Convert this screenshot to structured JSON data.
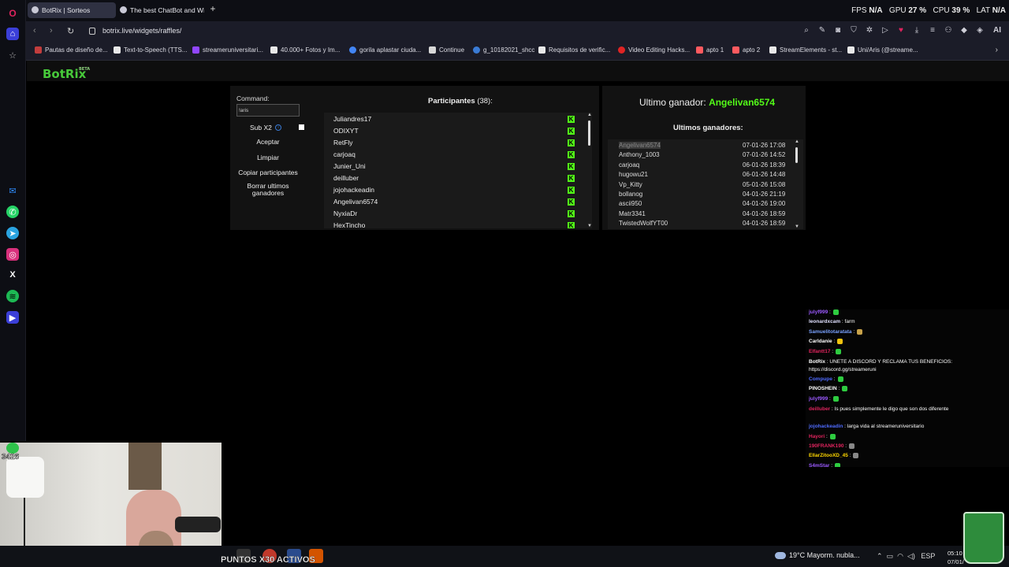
{
  "browser": {
    "tabs": [
      {
        "title": "BotRix | Sorteos"
      },
      {
        "title": "The best ChatBot and Wid"
      }
    ],
    "new_tab": "+",
    "stats": {
      "fps_label": "FPS",
      "fps_value": "N/A",
      "gpu_label": "GPU",
      "gpu_value": "27 %",
      "cpu_label": "CPU",
      "cpu_value": "39 %",
      "lat_label": "LAT",
      "lat_value": "N/A"
    },
    "url": "botrix.live/widgets/raffles/",
    "ai_label": "AI",
    "bookmarks": [
      {
        "label": "Pautas de diseño de...",
        "color": "#c23d3d"
      },
      {
        "label": "Text-to-Speech (TTS...",
        "color": "#e8e8e8"
      },
      {
        "label": "streameruniversitari...",
        "color": "#9146ff"
      },
      {
        "label": "40.000+ Fotos y Im...",
        "color": "#e8e8e8"
      },
      {
        "label": "gorila aplastar ciuda...",
        "color": "#4285f4"
      },
      {
        "label": "Continue",
        "color": "#d8d8d8"
      },
      {
        "label": "g_10182021_shcc",
        "color": "#3a7bd5"
      },
      {
        "label": "Requisitos de verific...",
        "color": "#e8e8e8"
      },
      {
        "label": "Video Editing Hacks...",
        "color": "#e02424"
      },
      {
        "label": "apto 1",
        "color": "#ff5a5f"
      },
      {
        "label": "apto 2",
        "color": "#ff5a5f"
      },
      {
        "label": "StreamElements - st...",
        "color": "#e8e8e8"
      },
      {
        "label": "Uni/Aris (@streame...",
        "color": "#e8e8e8"
      }
    ]
  },
  "app": {
    "logo": "BotRix",
    "logo_badge": "BETA",
    "command_label": "Command:",
    "command_value": "!aris",
    "sub_label": "Sub X2",
    "info_icon": "i",
    "buttons": {
      "accept": "Aceptar",
      "clear": "Limpiar",
      "copy": "Copiar participantes",
      "delete": "Borrar ultimos ganadores"
    },
    "participants_title": "Participantes",
    "participants_count": "(38):",
    "participants": [
      "Juliandres17",
      "ODIXYT",
      "RetFly",
      "carjoaq",
      "Junier_Uni",
      "deilluber",
      "jojohackeadin",
      "Angelivan6574",
      "NyxiaDr",
      "HexTincho"
    ],
    "kick_badge": "K",
    "last_winner_label": "Ultimo ganador:",
    "last_winner": "Angelivan6574",
    "last_winners_title": "Ultimos ganadores:",
    "winners": [
      {
        "name": "Angelivan6574",
        "date": "07-01-26 17:08"
      },
      {
        "name": "Anthony_1003",
        "date": "07-01-26 14:52"
      },
      {
        "name": "carjoaq",
        "date": "06-01-26 18:39"
      },
      {
        "name": "hugowu21",
        "date": "06-01-26 14:48"
      },
      {
        "name": "Vp_Kitty",
        "date": "05-01-26 15:08"
      },
      {
        "name": "bollanog",
        "date": "04-01-26 21:19"
      },
      {
        "name": "ascii950",
        "date": "04-01-26 19:00"
      },
      {
        "name": "Matr3341",
        "date": "04-01-26 18:59"
      },
      {
        "name": "TwistedWolfYT00",
        "date": "04-01-26 18:59"
      }
    ]
  },
  "chat": [
    {
      "user": "julyf999",
      "text": ":",
      "color": "#9b59ff",
      "emote": "#2ecc40"
    },
    {
      "user": "leonardxcam",
      "text": ": farm",
      "color": "#e0e0ff",
      "emote": ""
    },
    {
      "user": "Samuelitotaratata",
      "text": ":",
      "color": "#7aa2ff",
      "emote": "#c8a24a"
    },
    {
      "user": "Carldanie",
      "text": ":",
      "color": "#ffffff",
      "emote": "#f1c40f"
    },
    {
      "user": "Elfantt17",
      "text": ":",
      "color": "#e0245e",
      "emote": "#2ecc40"
    },
    {
      "user": "BotRix",
      "text": ": UNETE A DISCORD Y RECLAMA TUS BENEFICIOS: https://discord.gg/streameruni",
      "color": "#ffffff",
      "emote": ""
    },
    {
      "user": "Compupe",
      "text": ":",
      "color": "#4f6bff",
      "emote": "#2ecc40"
    },
    {
      "user": "PINOSHEIN",
      "text": ":",
      "color": "#ffffff",
      "emote": "#2ecc40"
    },
    {
      "user": "julyf999",
      "text": ":",
      "color": "#9b59ff",
      "emote": "#2ecc40"
    },
    {
      "user": "deilluber",
      "text": ": Is pues simplemente le digo que son dos diferente",
      "color": "#e0245e",
      "emote": ""
    },
    {
      "user": "jojohackeadin",
      "text": ": larga vida al streameruniversitario",
      "color": "#4f6bff",
      "emote": ""
    },
    {
      "user": "Hayori",
      "text": ":",
      "color": "#e0245e",
      "emote": "#2ecc40"
    },
    {
      "user": "190FRANK190",
      "text": ":",
      "color": "#e0245e",
      "emote": "#888888"
    },
    {
      "user": "EllarZitooXD_45",
      "text": ":",
      "color": "#ffd700",
      "emote": "#888888"
    },
    {
      "user": "S4mStar",
      "text": ":",
      "color": "#9b59ff",
      "emote": "#2ecc40"
    }
  ],
  "overlay": {
    "ticker": "PUNTOS X30 ACTIVOS",
    "avatar_number": "3426"
  },
  "taskbar": {
    "weather": "19°C  Mayorm. nubla...",
    "language": "ESP",
    "time": "05:10",
    "date": "07/01/"
  }
}
